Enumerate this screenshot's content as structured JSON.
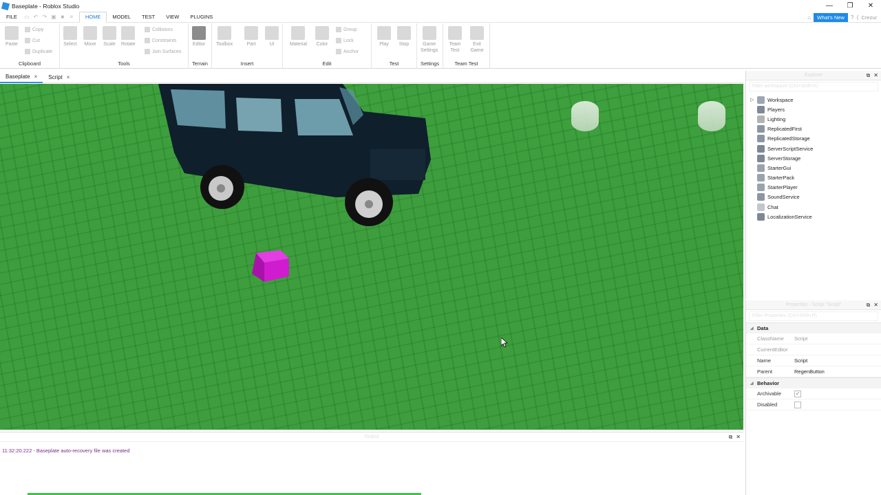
{
  "window": {
    "title": "Baseplate - Roblox Studio"
  },
  "menubar": {
    "file": "FILE",
    "tabs": [
      "HOME",
      "MODEL",
      "TEST",
      "VIEW",
      "PLUGINS"
    ],
    "whats_new": "What's New",
    "user": "Crezur"
  },
  "ribbon": {
    "clipboard": {
      "label": "Clipboard",
      "paste": "Paste",
      "copy": "Copy",
      "cut": "Cut",
      "duplicate": "Duplicate"
    },
    "tools": {
      "label": "Tools",
      "select": "Select",
      "move": "Move",
      "scale": "Scale",
      "rotate": "Rotate",
      "collisions": "Collisions",
      "constraints": "Constraints",
      "join_surfaces": "Join Surfaces"
    },
    "terrain": {
      "label": "Terrain",
      "editor": "Editor"
    },
    "insert": {
      "label": "Insert",
      "toolbox": "Toolbox",
      "part": "Part",
      "ui": "UI"
    },
    "edit": {
      "label": "Edit",
      "material": "Material",
      "color": "Color",
      "group": "Group",
      "lock": "Lock",
      "anchor": "Anchor"
    },
    "test": {
      "label": "Test",
      "play": "Play",
      "stop": "Stop"
    },
    "settings": {
      "label": "Settings",
      "game_settings_1": "Game",
      "game_settings_2": "Settings"
    },
    "team_test": {
      "label": "Team Test",
      "team_1": "Team",
      "team_2": "Test",
      "exit_1": "Exit",
      "exit_2": "Game"
    }
  },
  "doctabs": [
    {
      "label": "Baseplate",
      "close": "×"
    },
    {
      "label": "Script",
      "close": "×"
    }
  ],
  "output": {
    "title": "Output",
    "log": "11:32:20.222 - Baseplate auto-recovery file was created"
  },
  "explorer": {
    "title": "Explorer",
    "search_placeholder": "Filter workspace (Ctrl+Shift+X)",
    "items": [
      {
        "label": "Workspace",
        "icon": "workspace-icon",
        "color": "#9da7b1"
      },
      {
        "label": "Players",
        "icon": "players-icon",
        "color": "#7f8a96"
      },
      {
        "label": "Lighting",
        "icon": "lighting-icon",
        "color": "#b3b3b3"
      },
      {
        "label": "ReplicatedFirst",
        "icon": "replicated-first-icon",
        "color": "#8c96a3"
      },
      {
        "label": "ReplicatedStorage",
        "icon": "replicated-storage-icon",
        "color": "#8c96a3"
      },
      {
        "label": "ServerScriptService",
        "icon": "server-script-service-icon",
        "color": "#7e8895"
      },
      {
        "label": "ServerStorage",
        "icon": "server-storage-icon",
        "color": "#7e8895"
      },
      {
        "label": "StarterGui",
        "icon": "starter-gui-icon",
        "color": "#9aa3ad"
      },
      {
        "label": "StarterPack",
        "icon": "starter-pack-icon",
        "color": "#9aa3ad"
      },
      {
        "label": "StarterPlayer",
        "icon": "starter-player-icon",
        "color": "#9aa3ad"
      },
      {
        "label": "SoundService",
        "icon": "sound-service-icon",
        "color": "#8c96a3"
      },
      {
        "label": "Chat",
        "icon": "chat-icon",
        "color": "#c2c7cc"
      },
      {
        "label": "LocalizationService",
        "icon": "localization-service-icon",
        "color": "#7e8895"
      }
    ]
  },
  "properties": {
    "title": "Properties - Script \"Script\"",
    "search_placeholder": "Filter Properties (Ctrl+Shift+P)",
    "data_category": "Data",
    "behavior_category": "Behavior",
    "rows": {
      "class_name": {
        "key": "ClassName",
        "value": "Script"
      },
      "current_editor": {
        "key": "CurrentEditor",
        "value": ""
      },
      "name": {
        "key": "Name",
        "value": "Script"
      },
      "parent": {
        "key": "Parent",
        "value": "RegenButton"
      },
      "archivable": {
        "key": "Archivable",
        "value": "✓"
      },
      "disabled": {
        "key": "Disabled",
        "value": ""
      }
    }
  },
  "colors": {
    "accent": "#1f78d1",
    "baseplate_green": "#3f9f3f",
    "pink_part": "#d21bd2",
    "jeep_body": "#0e1e2a",
    "log_text": "#7a2a8a"
  }
}
